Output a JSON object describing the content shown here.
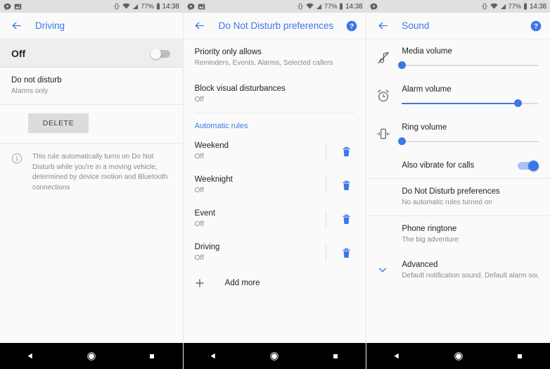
{
  "statusbar": {
    "notification_icons": [
      "message-icon",
      "image-icon"
    ],
    "vibrate_icon": "vibrate-icon",
    "wifi_icon": "wifi-icon",
    "signal_icon": "signal-icon",
    "battery_percent": "77%",
    "battery_icon": "battery-icon",
    "time": "14:38"
  },
  "navbar": {
    "back": "back-triangle-icon",
    "home": "home-circle-icon",
    "recents": "recents-square-icon"
  },
  "panel1": {
    "title": "Driving",
    "back_icon": "arrow-back-icon",
    "toggle": {
      "label": "Off",
      "state": "off"
    },
    "dnd_row": {
      "title": "Do not disturb",
      "subtitle": "Alarms only"
    },
    "delete_button": "DELETE",
    "info_icon": "info-icon",
    "info_text": "This rule automatically turns on Do Not Disturb while you're in a moving vehicle, determined by device motion and Bluetooth connections"
  },
  "panel2": {
    "title": "Do Not Disturb preferences",
    "back_icon": "arrow-back-icon",
    "help_icon": "help-icon",
    "rows": [
      {
        "title": "Priority only allows",
        "subtitle": "Reminders, Events, Alarms, Selected callers"
      },
      {
        "title": "Block visual disturbances",
        "subtitle": "Off"
      }
    ],
    "section_label": "Automatic rules",
    "rules": [
      {
        "title": "Weekend",
        "subtitle": "Off",
        "delete_icon": "trash-icon"
      },
      {
        "title": "Weeknight",
        "subtitle": "Off",
        "delete_icon": "trash-icon"
      },
      {
        "title": "Event",
        "subtitle": "Off",
        "delete_icon": "trash-icon"
      },
      {
        "title": "Driving",
        "subtitle": "Off",
        "delete_icon": "trash-icon"
      }
    ],
    "add_more": {
      "label": "Add more",
      "icon": "plus-icon"
    }
  },
  "panel3": {
    "title": "Sound",
    "back_icon": "arrow-back-icon",
    "help_icon": "help-icon",
    "volumes": [
      {
        "label": "Media volume",
        "icon": "music-note-muted-icon",
        "value": 0
      },
      {
        "label": "Alarm volume",
        "icon": "alarm-clock-icon",
        "value": 85
      },
      {
        "label": "Ring volume",
        "icon": "vibrate-icon",
        "value": 0
      }
    ],
    "vibrate_row": {
      "label": "Also vibrate for calls",
      "state": "on"
    },
    "rows": [
      {
        "title": "Do Not Disturb preferences",
        "subtitle": "No automatic rules turned on"
      },
      {
        "title": "Phone ringtone",
        "subtitle": "The big adventure"
      }
    ],
    "advanced": {
      "title": "Advanced",
      "subtitle": "Default notification sound, Default alarm sound, Ot..",
      "icon": "chevron-down-icon"
    }
  },
  "colors": {
    "accent": "#3b78e7",
    "statusbar_bg": "#e0e0e0",
    "page_bg": "#fafafa",
    "navbar_bg": "#000000"
  }
}
